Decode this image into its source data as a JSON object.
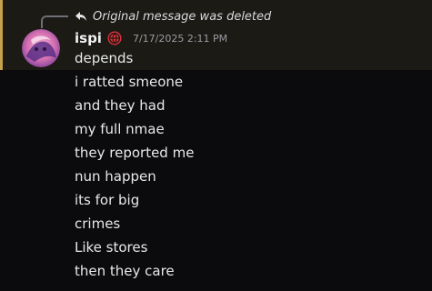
{
  "reply": {
    "icon": "reply-arrow-icon",
    "text": "Original message was deleted"
  },
  "message": {
    "username": "ispi",
    "badge_icon": "globe-icon",
    "timestamp": "7/17/2025 2:11 PM",
    "lines": [
      "depends",
      "i ratted smeone",
      "and they had",
      "my full nmae",
      "they reported me",
      "nun happen",
      "its for big",
      "crimes",
      "Like stores",
      "then they care"
    ]
  },
  "colors": {
    "background": "#0b0b0d",
    "highlight_background": "#1c1a14",
    "highlight_border": "#c8a24a",
    "badge_red": "#e0323f"
  }
}
